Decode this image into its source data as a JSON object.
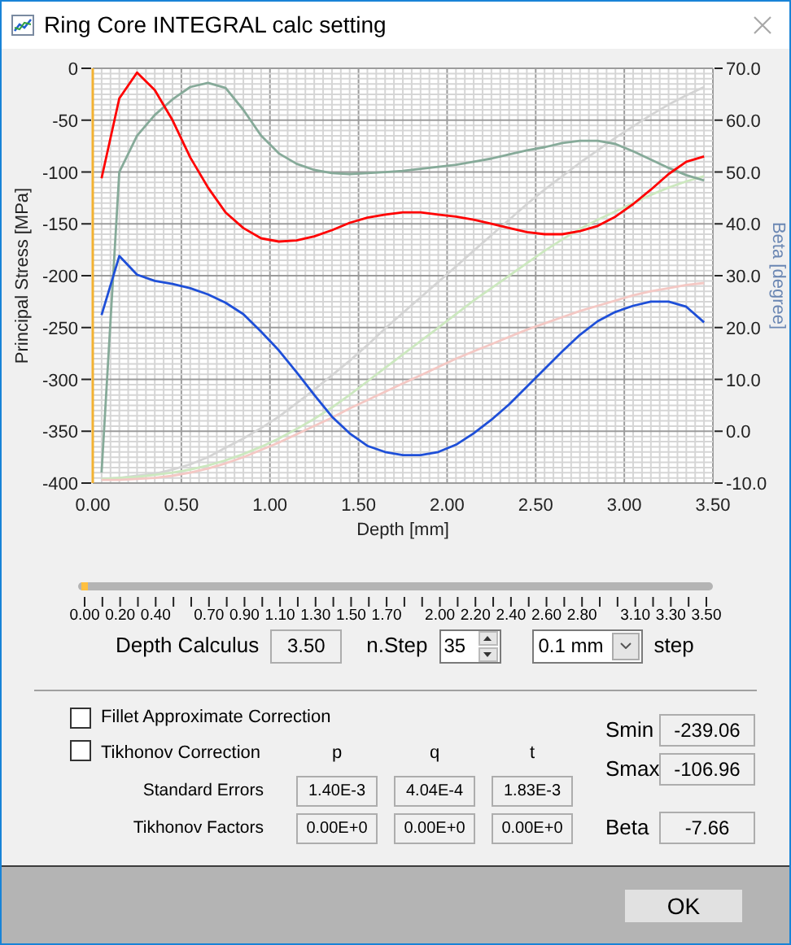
{
  "window": {
    "title": "Ring Core INTEGRAL calc setting"
  },
  "chart": {
    "chart_data": {
      "type": "line",
      "grid": true,
      "xlabel": "Depth [mm]",
      "ylabel": "Principal Stress [MPa]",
      "y2label": "Beta [degree]",
      "x": [
        0.05,
        0.15,
        0.25,
        0.35,
        0.45,
        0.55,
        0.65,
        0.75,
        0.85,
        0.95,
        1.05,
        1.15,
        1.25,
        1.35,
        1.45,
        1.55,
        1.65,
        1.75,
        1.85,
        1.95,
        2.05,
        2.15,
        2.25,
        2.35,
        2.45,
        2.55,
        2.65,
        2.75,
        2.85,
        2.95,
        3.05,
        3.15,
        3.25,
        3.35,
        3.45
      ],
      "xlim": [
        0,
        3.5
      ],
      "ylim": [
        -400,
        0
      ],
      "y2lim": [
        -10,
        70
      ],
      "xticks": [
        {
          "value": 0,
          "label": "0.00"
        },
        {
          "value": 0.5,
          "label": "0.50"
        },
        {
          "value": 1,
          "label": "1.00"
        },
        {
          "value": 1.5,
          "label": "1.50"
        },
        {
          "value": 2,
          "label": "2.00"
        },
        {
          "value": 2.5,
          "label": "2.50"
        },
        {
          "value": 3,
          "label": "3.00"
        },
        {
          "value": 3.5,
          "label": "3.50"
        }
      ],
      "yticks": [
        0,
        -50,
        -100,
        -150,
        -200,
        -250,
        -300,
        -350,
        -400
      ],
      "y2ticks": [
        {
          "value": 70,
          "label": "70.0"
        },
        {
          "value": 60,
          "label": "60.0"
        },
        {
          "value": 50,
          "label": "50.0"
        },
        {
          "value": 40,
          "label": "40.0"
        },
        {
          "value": 30,
          "label": "30.0"
        },
        {
          "value": 20,
          "label": "20.0"
        },
        {
          "value": 10,
          "label": "10.0"
        },
        {
          "value": 0,
          "label": "0.0"
        },
        {
          "value": -10,
          "label": "-10.0"
        }
      ],
      "series": [
        {
          "color": "#d4d4d4",
          "values": [
            -396,
            -395,
            -393,
            -391,
            -387,
            -382,
            -375,
            -366,
            -357,
            -347,
            -336,
            -323,
            -310,
            -296,
            -282,
            -267,
            -251,
            -236,
            -221,
            -206,
            -191,
            -176,
            -161,
            -146,
            -131,
            -117,
            -104,
            -91,
            -79,
            -67,
            -56,
            -45,
            -35,
            -26,
            -18
          ]
        },
        {
          "color": "#cce8bf",
          "values": [
            -396,
            -395,
            -394,
            -392,
            -390,
            -387,
            -383,
            -378,
            -372,
            -365,
            -357,
            -348,
            -338,
            -327,
            -315,
            -302,
            -289,
            -276,
            -263,
            -250,
            -237,
            -224,
            -212,
            -200,
            -188,
            -176,
            -165,
            -155,
            -146,
            -138,
            -130,
            -122,
            -115,
            -109,
            -104
          ]
        },
        {
          "color": "#f4c8c4",
          "values": [
            -397,
            -397,
            -396,
            -395,
            -393,
            -390,
            -386,
            -381,
            -375,
            -368,
            -361,
            -353,
            -345,
            -337,
            -328,
            -320,
            -312,
            -304,
            -296,
            -288,
            -280,
            -273,
            -266,
            -259,
            -252,
            -246,
            -240,
            -234,
            -229,
            -224,
            -219,
            -215,
            -212,
            -209,
            -207
          ]
        },
        {
          "color": "#86aa99",
          "values": [
            -390,
            -100,
            -65,
            -45,
            -30,
            -18,
            -14,
            -19,
            -40,
            -65,
            -82,
            -92,
            -98,
            -101,
            -102,
            -101,
            -100,
            -99,
            -97,
            -95,
            -93,
            -90,
            -87,
            -83,
            -79,
            -76,
            -72,
            -70,
            -70,
            -73,
            -80,
            -88,
            -96,
            -103,
            -108
          ]
        },
        {
          "color": "#ff0000",
          "values": [
            -106,
            -29,
            -4,
            -21,
            -50,
            -86,
            -115,
            -139,
            -154,
            -164,
            -167,
            -166,
            -162,
            -156,
            -149,
            -144,
            -141,
            -139,
            -139,
            -141,
            -143,
            -146,
            -150,
            -154,
            -158,
            -160,
            -160,
            -157,
            -152,
            -143,
            -131,
            -117,
            -102,
            -90,
            -85
          ]
        },
        {
          "color": "#1e4fd8",
          "values": [
            -238,
            -181,
            -199,
            -205,
            -208,
            -212,
            -218,
            -226,
            -237,
            -254,
            -272,
            -293,
            -315,
            -336,
            -352,
            -364,
            -370,
            -373,
            -373,
            -370,
            -363,
            -352,
            -339,
            -324,
            -307,
            -290,
            -273,
            -257,
            -244,
            -235,
            -229,
            -225,
            -225,
            -230,
            -245
          ]
        }
      ]
    }
  },
  "depth_slider": {
    "level": 0,
    "tick_labels": [
      "0.00",
      "0.20",
      "0.40",
      "0.70",
      "0.90",
      "1.10",
      "1.30",
      "1.50",
      "1.70",
      "2.00",
      "2.20",
      "2.40",
      "2.60",
      "2.80",
      "3.10",
      "3.30",
      "3.50"
    ]
  },
  "depth_calculus": {
    "label": "Depth Calculus",
    "value": "3.50"
  },
  "n_step": {
    "label": "n.Step",
    "value": "35"
  },
  "step_size": {
    "value": "0.1 mm",
    "label": "step"
  },
  "options": [
    {
      "label": "Fillet Approximate Correction",
      "checked": false
    },
    {
      "label": "Tikhonov Correction",
      "checked": false
    }
  ],
  "parameters": {
    "columns": [
      "p",
      "q",
      "t"
    ],
    "rows": [
      {
        "label": "Standard Errors",
        "values": [
          "1.40E-3",
          "4.04E-4",
          "1.83E-3"
        ]
      },
      {
        "label": "Tikhonov Factors",
        "values": [
          "0.00E+0",
          "0.00E+0",
          "0.00E+0"
        ]
      }
    ]
  },
  "results": [
    {
      "label": "Smin",
      "value": "-239.06"
    },
    {
      "label": "Smax",
      "value": "-106.96"
    },
    {
      "label": "Beta",
      "value": "-7.66"
    }
  ],
  "buttons": [
    "OK"
  ]
}
